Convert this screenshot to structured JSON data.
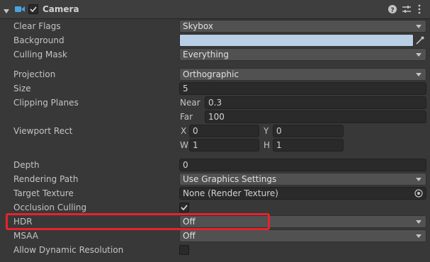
{
  "header": {
    "title": "Camera"
  },
  "fields": {
    "clear_flags": {
      "label": "Clear Flags",
      "value": "Skybox"
    },
    "background": {
      "label": "Background",
      "color": "#b8cfe6"
    },
    "culling_mask": {
      "label": "Culling Mask",
      "value": "Everything"
    },
    "projection": {
      "label": "Projection",
      "value": "Orthographic"
    },
    "size": {
      "label": "Size",
      "value": "5"
    },
    "clipping_planes": {
      "label": "Clipping Planes",
      "near_label": "Near",
      "near_value": "0.3",
      "far_label": "Far",
      "far_value": "100"
    },
    "viewport_rect": {
      "label": "Viewport Rect",
      "x_label": "X",
      "x_value": "0",
      "y_label": "Y",
      "y_value": "0",
      "w_label": "W",
      "w_value": "1",
      "h_label": "H",
      "h_value": "1"
    },
    "depth": {
      "label": "Depth",
      "value": "0"
    },
    "rendering_path": {
      "label": "Rendering Path",
      "value": "Use Graphics Settings"
    },
    "target_texture": {
      "label": "Target Texture",
      "value": "None (Render Texture)"
    },
    "occlusion_culling": {
      "label": "Occlusion Culling",
      "checked": true
    },
    "hdr": {
      "label": "HDR",
      "value": "Off"
    },
    "msaa": {
      "label": "MSAA",
      "value": "Off"
    },
    "allow_dynamic_resolution": {
      "label": "Allow Dynamic Resolution",
      "checked": false
    }
  },
  "colors": {
    "highlight": "#e8232b",
    "panel": "#383838",
    "accent_check": "#e0e0e0"
  },
  "icons": [
    "foldout-arrow-icon",
    "camera-icon",
    "enabled-checkbox",
    "help-icon",
    "presets-icon",
    "kebab-menu-icon",
    "eyedropper-icon",
    "object-picker-icon"
  ]
}
